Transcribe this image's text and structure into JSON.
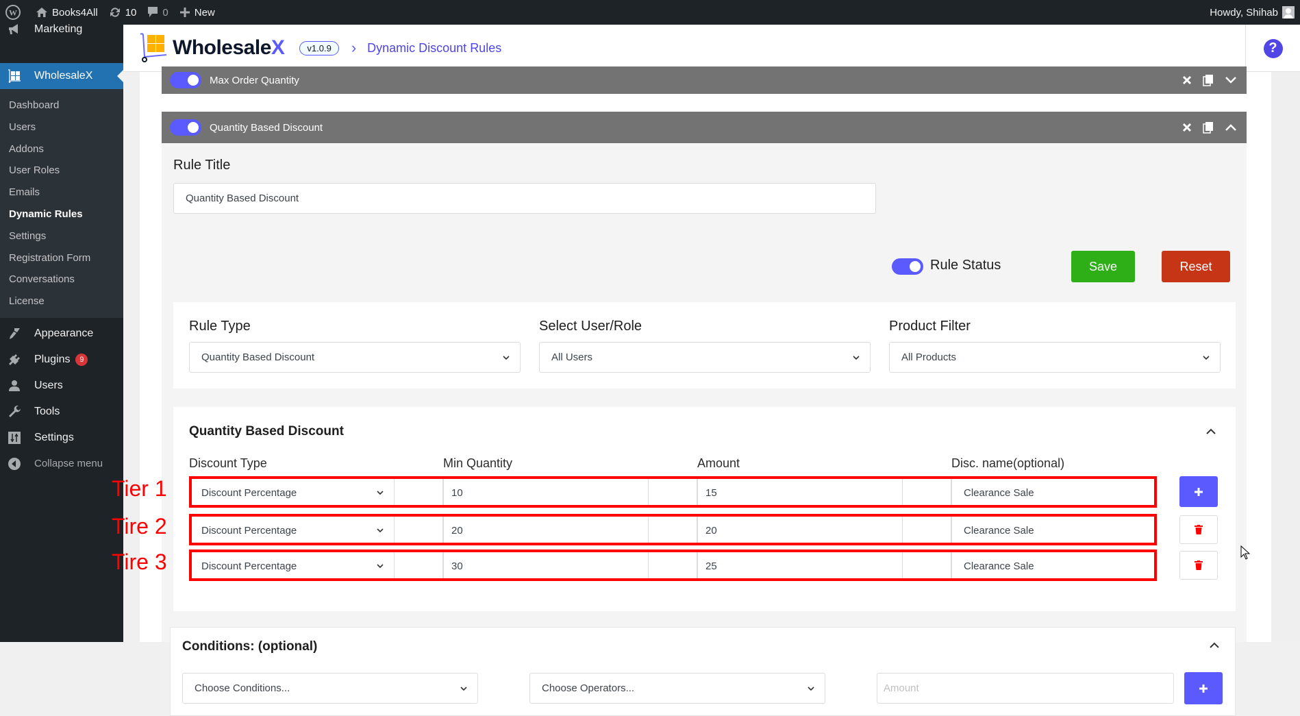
{
  "admin_bar": {
    "site_name": "Books4All",
    "updates_count": "10",
    "comments_count": "0",
    "new_label": "New",
    "greeting": "Howdy, Shihab"
  },
  "sidebar": {
    "marketing_label": "Marketing",
    "current_plugin": "WholesaleX",
    "submenu": [
      {
        "label": "Dashboard",
        "active": false
      },
      {
        "label": "Users",
        "active": false
      },
      {
        "label": "Addons",
        "active": false
      },
      {
        "label": "User Roles",
        "active": false
      },
      {
        "label": "Emails",
        "active": false
      },
      {
        "label": "Dynamic Rules",
        "active": true
      },
      {
        "label": "Settings",
        "active": false
      },
      {
        "label": "Registration Form",
        "active": false
      },
      {
        "label": "Conversations",
        "active": false
      },
      {
        "label": "License",
        "active": false
      }
    ],
    "menu": [
      {
        "label": "Appearance",
        "icon": "paintbrush-icon"
      },
      {
        "label": "Plugins",
        "icon": "plug-icon",
        "badge": "9"
      },
      {
        "label": "Users",
        "icon": "user-icon"
      },
      {
        "label": "Tools",
        "icon": "wrench-icon"
      },
      {
        "label": "Settings",
        "icon": "sliders-icon"
      }
    ],
    "collapse_label": "Collapse menu"
  },
  "header": {
    "brand_main": "Wholesale",
    "brand_accent": "X",
    "version": "v1.0.9",
    "breadcrumb": "Dynamic Discount Rules",
    "help": "?"
  },
  "rules": [
    {
      "title": "Max Order Quantity",
      "enabled": true,
      "expanded": false
    },
    {
      "title": "Quantity Based Discount",
      "enabled": true,
      "expanded": true
    }
  ],
  "editor": {
    "rule_title_label": "Rule Title",
    "rule_title_value": "Quantity Based Discount",
    "rule_status_label": "Rule Status",
    "rule_status_on": true,
    "save_label": "Save",
    "reset_label": "Reset",
    "rule_type_label": "Rule Type",
    "rule_type_value": "Quantity Based Discount",
    "user_role_label": "Select User/Role",
    "user_role_value": "All Users",
    "product_filter_label": "Product Filter",
    "product_filter_value": "All Products"
  },
  "qbd": {
    "section_title": "Quantity Based Discount",
    "columns": [
      "Discount Type",
      "Min Quantity",
      "Amount",
      "Disc. name(optional)"
    ],
    "tiers": [
      {
        "annotation": "Tier 1",
        "discount_type": "Discount Percentage",
        "min_quantity": "10",
        "amount": "15",
        "name": "Clearance Sale",
        "action": "add"
      },
      {
        "annotation": "Tire 2",
        "discount_type": "Discount Percentage",
        "min_quantity": "20",
        "amount": "20",
        "name": "Clearance Sale",
        "action": "delete"
      },
      {
        "annotation": "Tire 3",
        "discount_type": "Discount Percentage",
        "min_quantity": "30",
        "amount": "25",
        "name": "Clearance Sale",
        "action": "delete"
      }
    ]
  },
  "conditions": {
    "title": "Conditions: (optional)",
    "condition_placeholder": "Choose Conditions...",
    "operator_placeholder": "Choose Operators...",
    "amount_placeholder": "Amount"
  },
  "colors": {
    "accent": "#5a5aff",
    "save": "#2eaf18",
    "reset": "#c63516",
    "annotation": "#ff0000",
    "wp_blue": "#2271b1"
  }
}
